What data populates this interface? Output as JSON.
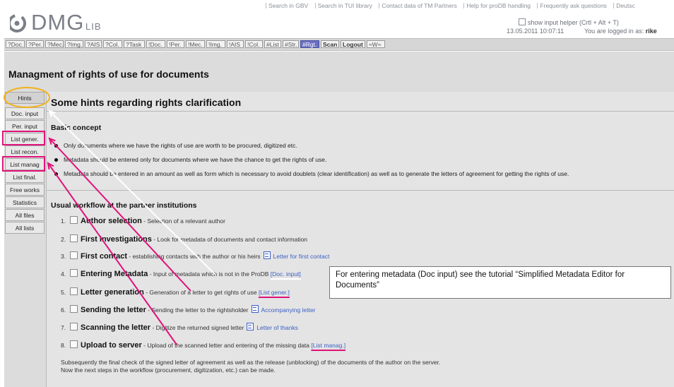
{
  "logo": {
    "text": "DMG",
    "sub": "LIB"
  },
  "top_links": [
    "Search in GBV",
    "Search in TUI library",
    "Contact data of TM Partners",
    "Help for proDB handling",
    "Frequently ask questions",
    "Deutsc"
  ],
  "input_helper": {
    "label": "show input helper (Crtl + Alt + T)",
    "checked": false
  },
  "session": {
    "datetime": "13.05.2011 10:07:11",
    "logged_in_label": "You are logged in as:",
    "user": "rike"
  },
  "toolbar": [
    "?Doc.",
    "?Per.",
    "?Mec.",
    "?Img.",
    "?AIS",
    "?Col.",
    "?Task",
    "!Doc.",
    "!Per.",
    "!Mec.",
    "!Img.",
    "!AIS",
    "!Col.",
    "#List",
    "#Str.",
    "#Rgt.",
    "Scan",
    "Logout",
    "≈W≈"
  ],
  "toolbar_active": "#Rgt.",
  "page_title": "Managment of rights of use for documents",
  "sidebar": [
    "Hints",
    "Doc. input",
    "Per. input",
    "List gener.",
    "List recon.",
    "List manag",
    "List final.",
    "Free works",
    "Statistics",
    "All files",
    "All lists"
  ],
  "sidebar_active": "Hints",
  "hints_heading": "Some hints regarding rights clarification",
  "basic_concept": {
    "heading": "Basic concept",
    "bullets": [
      "Only documents where we have the rights of use are worth to be procured, digitized etc.",
      "Metadata should be entered only for documents where we have the chance to get the rights of use.",
      "Metadata should be entered in an amount as well as form which is necessary to avoid doublets (clear identification) as well as to generate the letters of agreement for getting the rights of use."
    ]
  },
  "workflow": {
    "heading": "Usual workflow at the partner institutions",
    "steps": [
      {
        "num": "1.",
        "title": "Author selection",
        "desc": " - Selection of a relevant author",
        "link": ""
      },
      {
        "num": "2.",
        "title": "First investigations",
        "desc": " - Look for metadata of documents and contact information",
        "link": ""
      },
      {
        "num": "3.",
        "title": "First contact",
        "desc": " - establishing contacts with the author or his heirs",
        "link": "Letter for first contact"
      },
      {
        "num": "4.",
        "title": "Entering Metadata",
        "desc": " - Input of metadata which is not in the ProDB",
        "link": "[Doc. input]"
      },
      {
        "num": "5.",
        "title": "Letter generation",
        "desc": " - Generation of a letter to get rights of use",
        "link": "[List gener.]"
      },
      {
        "num": "6.",
        "title": "Sending the letter",
        "desc": " - Sending the letter to the rightsholder",
        "link": "Accompanying letter"
      },
      {
        "num": "7.",
        "title": "Scanning the letter",
        "desc": " - Digitize the returned signed letter",
        "link": "Letter of thanks"
      },
      {
        "num": "8.",
        "title": "Upload to server",
        "desc": " - Upload of the scanned letter and entering of the missing data",
        "link": "[List manag.]"
      }
    ],
    "final_line1": "Subsequently the final check of the signed letter of agreement as well as the release (unblocking) of the documents of the author on the server.",
    "final_line2": "Now the next steps in the workflow (procurement, digitization, etc.) can be made."
  },
  "callout": {
    "text": "For entering metadata (Doc input) see the tutorial “Simplified Metadata Editor for Documents”"
  },
  "colors": {
    "annotation_pink": "#e0127a",
    "annotation_orange": "#f2b21b",
    "annotation_white": "#ffffff",
    "link_blue": "#3b5fc5",
    "active_tab": "#6a6fc2"
  }
}
